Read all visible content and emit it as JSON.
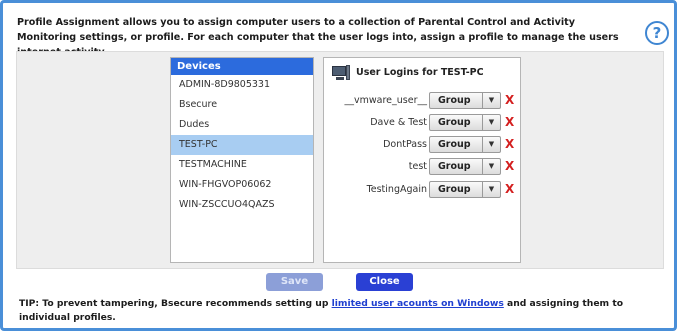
{
  "intro_text": "Profile Assignment allows you to assign computer users to a collection of Parental Control and Activity Monitoring settings, or profile. For each computer that the user logs into, assign a profile to manage the users internet activity.",
  "help_icon": {
    "glyph": "?",
    "name": "help-icon"
  },
  "devices": {
    "header": "Devices",
    "items": [
      {
        "label": "ADMIN-8D9805331",
        "selected": false
      },
      {
        "label": "Bsecure",
        "selected": false
      },
      {
        "label": "Dudes",
        "selected": false
      },
      {
        "label": "TEST-PC",
        "selected": true
      },
      {
        "label": "TESTMACHINE",
        "selected": false
      },
      {
        "label": "WIN-FHGVOP06062",
        "selected": false
      },
      {
        "label": "WIN-ZSCCUO4QAZS",
        "selected": false
      }
    ]
  },
  "logins": {
    "header": "User Logins for TEST-PC",
    "icon": "computer-icon",
    "rows": [
      {
        "user": "__vmware_user__",
        "profile": "Group"
      },
      {
        "user": "Dave & Test",
        "profile": "Group"
      },
      {
        "user": "DontPass",
        "profile": "Group"
      },
      {
        "user": "test",
        "profile": "Group"
      },
      {
        "user": "TestingAgain",
        "profile": "Group"
      }
    ],
    "remove_glyph": "X",
    "dropdown_glyph": "▼"
  },
  "buttons": {
    "save": "Save",
    "close": "Close"
  },
  "tip": {
    "prefix": "TIP: To prevent tampering, Bsecure recommends setting up ",
    "link": "limited user acounts on Windows",
    "suffix": " and assigning them to individual profiles."
  },
  "colors": {
    "frame_border": "#4a8fd8",
    "devices_header": "#2c6bdd",
    "selected_row": "#a8cdf2",
    "close_button": "#2a40d4",
    "save_button_disabled": "#8c9fd8",
    "remove_x": "#d42020"
  }
}
